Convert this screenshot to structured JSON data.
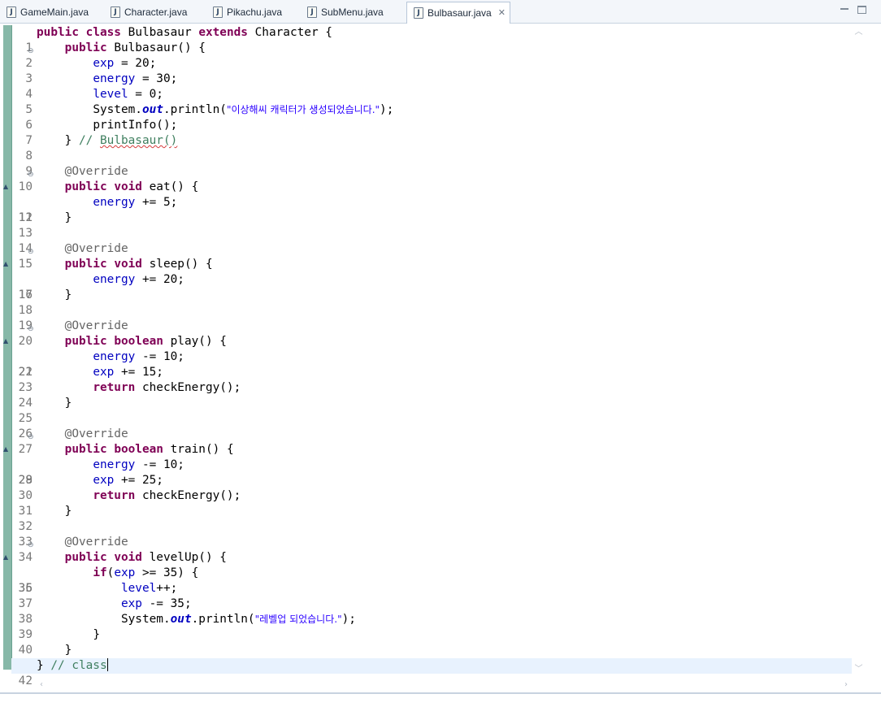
{
  "tabs": [
    {
      "label": "GameMain.java",
      "active": false
    },
    {
      "label": "Character.java",
      "active": false
    },
    {
      "label": "Pikachu.java",
      "active": false
    },
    {
      "label": "SubMenu.java",
      "active": false
    },
    {
      "label": "Bulbasaur.java",
      "active": true
    }
  ],
  "editor": {
    "file_icon": "java-file-icon",
    "current_line": 42,
    "line_numbers": [
      "1",
      "2",
      "3",
      "4",
      "5",
      "6",
      "7",
      "8",
      "9",
      "10",
      "11",
      "12",
      "13",
      "14",
      "15",
      "16",
      "17",
      "18",
      "19",
      "20",
      "21",
      "22",
      "23",
      "24",
      "25",
      "26",
      "27",
      "28",
      "29",
      "30",
      "31",
      "32",
      "33",
      "34",
      "35",
      "36",
      "37",
      "38",
      "39",
      "40",
      "41",
      "42"
    ],
    "lines": {
      "l1": {
        "kw1": "public",
        "kw2": "class",
        "name": "Bulbasaur",
        "kw3": "extends",
        "parent": "Character {"
      },
      "l2": {
        "kw": "public",
        "rest": "Bulbasaur() {"
      },
      "l3": {
        "fld": "exp",
        "rest": " = 20;"
      },
      "l4": {
        "fld": "energy",
        "rest": " = 30;"
      },
      "l5": {
        "fld": "level",
        "rest": " = 0;"
      },
      "l6": {
        "pre": "System.",
        "sfld": "out",
        "mid": ".println(",
        "str": "\"이상해씨 캐릭터가 생성되었습니다.\"",
        "post": ");"
      },
      "l7": {
        "text": "printInfo();"
      },
      "l8": {
        "pre": "} ",
        "cmt1": "// ",
        "cmt2": "Bulbasaur()"
      },
      "l10": {
        "ann": "@Override"
      },
      "l11": {
        "kw1": "public",
        "kw2": "void",
        "rest": "eat() {"
      },
      "l12": {
        "fld": "energy",
        "rest": " += 5;"
      },
      "l13": {
        "text": "}"
      },
      "l15": {
        "ann": "@Override"
      },
      "l16": {
        "kw1": "public",
        "kw2": "void",
        "rest": "sleep() {"
      },
      "l17": {
        "fld": "energy",
        "rest": " += 20;"
      },
      "l18": {
        "text": "}"
      },
      "l20": {
        "ann": "@Override"
      },
      "l21": {
        "kw1": "public",
        "kw2": "boolean",
        "rest": "play() {"
      },
      "l22": {
        "fld": "energy",
        "rest": " -= 10;"
      },
      "l23": {
        "fld": "exp",
        "rest": " += 15;"
      },
      "l24": {
        "kw": "return",
        "rest": "checkEnergy();"
      },
      "l25": {
        "text": "}"
      },
      "l27": {
        "ann": "@Override"
      },
      "l28": {
        "kw1": "public",
        "kw2": "boolean",
        "rest": "train() {"
      },
      "l29": {
        "fld": "energy",
        "rest": " -= 10;"
      },
      "l30": {
        "fld": "exp",
        "rest": " += 25;"
      },
      "l31": {
        "kw": "return",
        "rest": "checkEnergy();"
      },
      "l32": {
        "text": "}"
      },
      "l34": {
        "ann": "@Override"
      },
      "l35": {
        "kw1": "public",
        "kw2": "void",
        "rest": "levelUp() {"
      },
      "l36": {
        "kw": "if",
        "pre": "(",
        "fld": "exp",
        "rest": " >= 35) {"
      },
      "l37": {
        "fld": "level",
        "rest": "++;"
      },
      "l38": {
        "fld": "exp",
        "rest": " -= 35;"
      },
      "l39": {
        "pre": "System.",
        "sfld": "out",
        "mid": ".println(",
        "str": "\"레벨업 되었습니다.\"",
        "post": ");"
      },
      "l40": {
        "text": "}"
      },
      "l41": {
        "text": "}"
      },
      "l42": {
        "pre": "} ",
        "cmt": "// class"
      }
    }
  }
}
